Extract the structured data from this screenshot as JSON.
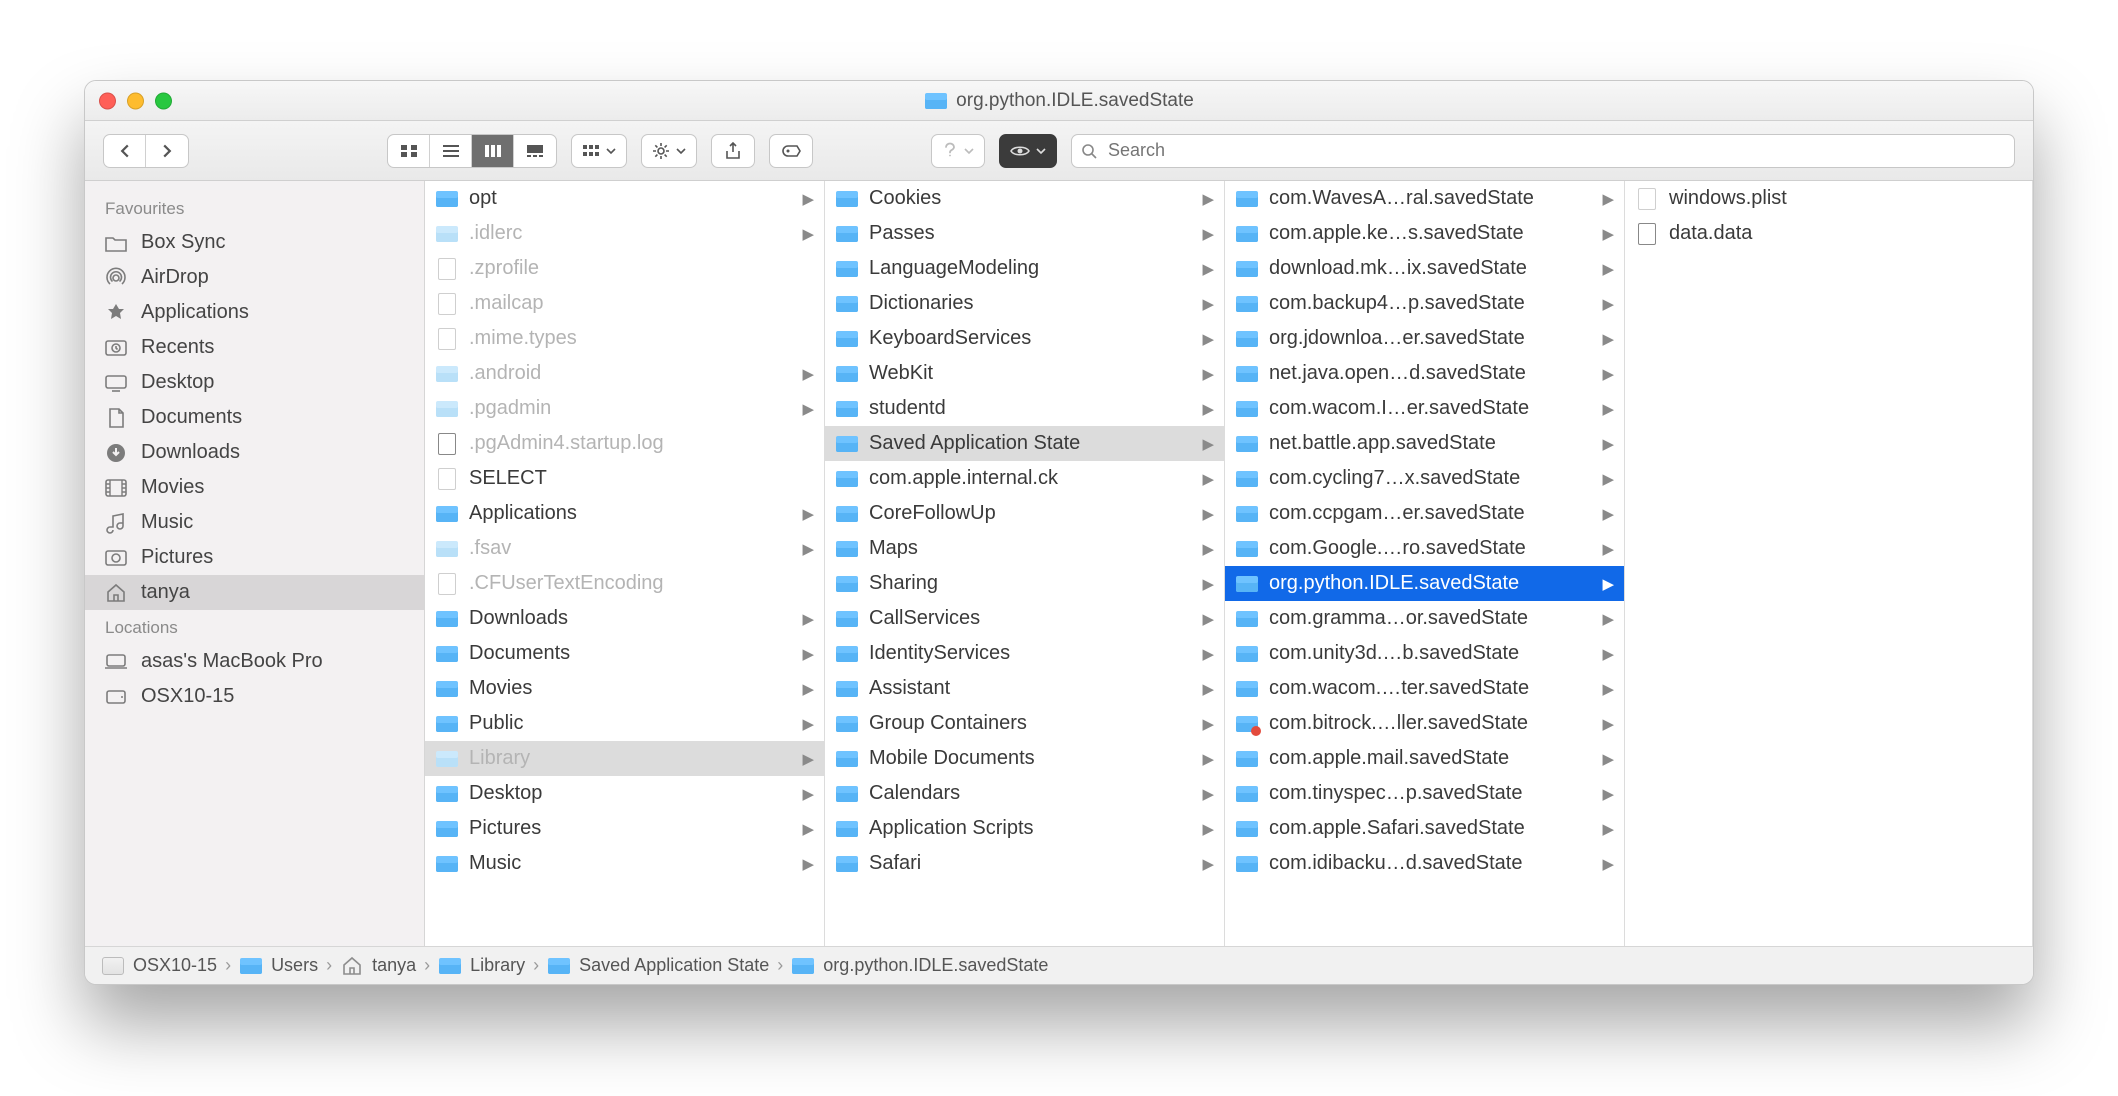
{
  "window": {
    "title": "org.python.IDLE.savedState"
  },
  "search": {
    "placeholder": "Search"
  },
  "sidebar": {
    "sections": [
      {
        "title": "Favourites",
        "items": [
          {
            "label": "Box Sync",
            "icon": "folder"
          },
          {
            "label": "AirDrop",
            "icon": "airdrop"
          },
          {
            "label": "Applications",
            "icon": "apps"
          },
          {
            "label": "Recents",
            "icon": "recents"
          },
          {
            "label": "Desktop",
            "icon": "desktop"
          },
          {
            "label": "Documents",
            "icon": "documents"
          },
          {
            "label": "Downloads",
            "icon": "downloads"
          },
          {
            "label": "Movies",
            "icon": "movies"
          },
          {
            "label": "Music",
            "icon": "music"
          },
          {
            "label": "Pictures",
            "icon": "pictures"
          },
          {
            "label": "tanya",
            "icon": "home",
            "selected": true
          }
        ]
      },
      {
        "title": "Locations",
        "items": [
          {
            "label": "asas's MacBook Pro",
            "icon": "computer"
          },
          {
            "label": "OSX10-15",
            "icon": "disk"
          }
        ]
      }
    ]
  },
  "columns": [
    {
      "items": [
        {
          "label": "opt",
          "kind": "folder",
          "arrow": true
        },
        {
          "label": ".idlerc",
          "kind": "folder-dim",
          "arrow": true,
          "dim": true
        },
        {
          "label": ".zprofile",
          "kind": "file",
          "dim": true
        },
        {
          "label": ".mailcap",
          "kind": "file",
          "dim": true
        },
        {
          "label": ".mime.types",
          "kind": "file",
          "dim": true
        },
        {
          "label": ".android",
          "kind": "folder-dim",
          "arrow": true,
          "dim": true
        },
        {
          "label": ".pgadmin",
          "kind": "folder-dim",
          "arrow": true,
          "dim": true
        },
        {
          "label": ".pgAdmin4.startup.log",
          "kind": "file-grey",
          "dim": true
        },
        {
          "label": "SELECT",
          "kind": "file"
        },
        {
          "label": "Applications",
          "kind": "folder",
          "arrow": true
        },
        {
          "label": ".fsav",
          "kind": "folder-dim",
          "arrow": true,
          "dim": true
        },
        {
          "label": ".CFUserTextEncoding",
          "kind": "file",
          "dim": true
        },
        {
          "label": "Downloads",
          "kind": "folder",
          "arrow": true
        },
        {
          "label": "Documents",
          "kind": "folder",
          "arrow": true
        },
        {
          "label": "Movies",
          "kind": "folder",
          "arrow": true
        },
        {
          "label": "Public",
          "kind": "folder",
          "arrow": true
        },
        {
          "label": "Library",
          "kind": "folder-dim",
          "arrow": true,
          "dim": true,
          "sel": "grey"
        },
        {
          "label": "Desktop",
          "kind": "folder",
          "arrow": true
        },
        {
          "label": "Pictures",
          "kind": "folder",
          "arrow": true
        },
        {
          "label": "Music",
          "kind": "folder",
          "arrow": true
        }
      ]
    },
    {
      "items": [
        {
          "label": "Cookies",
          "kind": "folder",
          "arrow": true
        },
        {
          "label": "Passes",
          "kind": "folder",
          "arrow": true
        },
        {
          "label": "LanguageModeling",
          "kind": "folder",
          "arrow": true
        },
        {
          "label": "Dictionaries",
          "kind": "folder",
          "arrow": true
        },
        {
          "label": "KeyboardServices",
          "kind": "folder",
          "arrow": true
        },
        {
          "label": "WebKit",
          "kind": "folder",
          "arrow": true
        },
        {
          "label": "studentd",
          "kind": "folder",
          "arrow": true
        },
        {
          "label": "Saved Application State",
          "kind": "folder",
          "arrow": true,
          "sel": "grey"
        },
        {
          "label": "com.apple.internal.ck",
          "kind": "folder",
          "arrow": true
        },
        {
          "label": "CoreFollowUp",
          "kind": "folder",
          "arrow": true
        },
        {
          "label": "Maps",
          "kind": "folder",
          "arrow": true
        },
        {
          "label": "Sharing",
          "kind": "folder",
          "arrow": true
        },
        {
          "label": "CallServices",
          "kind": "folder",
          "arrow": true
        },
        {
          "label": "IdentityServices",
          "kind": "folder",
          "arrow": true
        },
        {
          "label": "Assistant",
          "kind": "folder",
          "arrow": true
        },
        {
          "label": "Group Containers",
          "kind": "folder",
          "arrow": true
        },
        {
          "label": "Mobile Documents",
          "kind": "folder",
          "arrow": true
        },
        {
          "label": "Calendars",
          "kind": "folder",
          "arrow": true
        },
        {
          "label": "Application Scripts",
          "kind": "folder",
          "arrow": true
        },
        {
          "label": "Safari",
          "kind": "folder",
          "arrow": true
        }
      ]
    },
    {
      "items": [
        {
          "label": "com.WavesA…ral.savedState",
          "kind": "folder",
          "arrow": true
        },
        {
          "label": "com.apple.ke…s.savedState",
          "kind": "folder",
          "arrow": true
        },
        {
          "label": "download.mk…ix.savedState",
          "kind": "folder",
          "arrow": true
        },
        {
          "label": "com.backup4…p.savedState",
          "kind": "folder",
          "arrow": true
        },
        {
          "label": "org.jdownloa…er.savedState",
          "kind": "folder",
          "arrow": true
        },
        {
          "label": "net.java.open…d.savedState",
          "kind": "folder",
          "arrow": true
        },
        {
          "label": "com.wacom.I…er.savedState",
          "kind": "folder",
          "arrow": true
        },
        {
          "label": "net.battle.app.savedState",
          "kind": "folder",
          "arrow": true
        },
        {
          "label": "com.cycling7…x.savedState",
          "kind": "folder",
          "arrow": true
        },
        {
          "label": "com.ccpgam…er.savedState",
          "kind": "folder",
          "arrow": true
        },
        {
          "label": "com.Google.…ro.savedState",
          "kind": "folder",
          "arrow": true
        },
        {
          "label": "org.python.IDLE.savedState",
          "kind": "folder",
          "arrow": true,
          "sel": "blue"
        },
        {
          "label": "com.gramma…or.savedState",
          "kind": "folder",
          "arrow": true
        },
        {
          "label": "com.unity3d.…b.savedState",
          "kind": "folder",
          "arrow": true
        },
        {
          "label": "com.wacom.…ter.savedState",
          "kind": "folder",
          "arrow": true
        },
        {
          "label": "com.bitrock.…ller.savedState",
          "kind": "folder",
          "arrow": true,
          "badge": "x"
        },
        {
          "label": "com.apple.mail.savedState",
          "kind": "folder",
          "arrow": true
        },
        {
          "label": "com.tinyspec…p.savedState",
          "kind": "folder",
          "arrow": true
        },
        {
          "label": "com.apple.Safari.savedState",
          "kind": "folder",
          "arrow": true
        },
        {
          "label": "com.idibacku…d.savedState",
          "kind": "folder",
          "arrow": true
        }
      ]
    },
    {
      "items": [
        {
          "label": "windows.plist",
          "kind": "file"
        },
        {
          "label": "data.data",
          "kind": "file-grey"
        }
      ]
    }
  ],
  "pathbar": [
    {
      "label": "OSX10-15",
      "icon": "disk"
    },
    {
      "label": "Users",
      "icon": "folder"
    },
    {
      "label": "tanya",
      "icon": "home"
    },
    {
      "label": "Library",
      "icon": "folder"
    },
    {
      "label": "Saved Application State",
      "icon": "folder"
    },
    {
      "label": "org.python.IDLE.savedState",
      "icon": "folder"
    }
  ]
}
